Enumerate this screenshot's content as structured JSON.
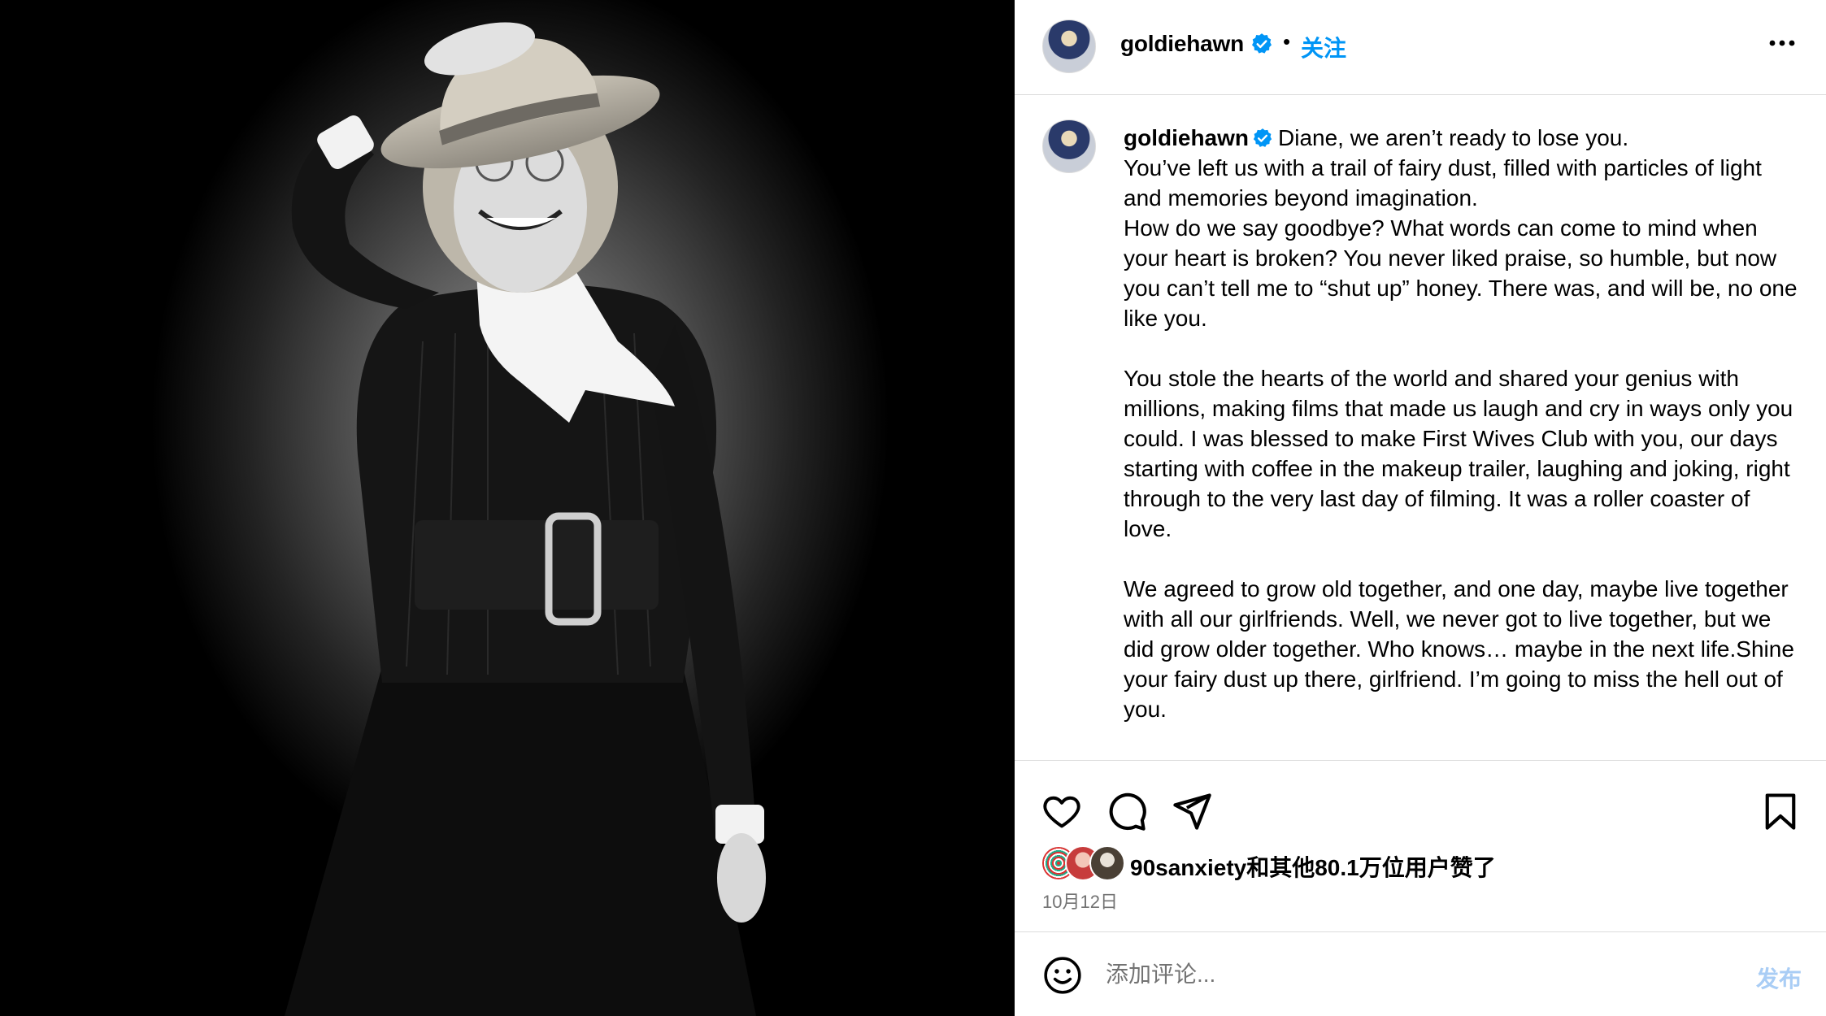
{
  "media": {
    "alt_icon": "photo-portrait",
    "colors": {
      "background": "#000000",
      "spotlight": "#9a9a9a"
    }
  },
  "post": {
    "header": {
      "username": "goldiehawn",
      "verified_icon": "verified-badge-icon",
      "separator": "•",
      "follow_label": "关注",
      "more_icon": "more-options-icon"
    },
    "caption": {
      "username": "goldiehawn",
      "text": "Diane, we aren’t ready to lose you.\nYou’ve left us with a trail of fairy dust, filled with particles of light and memories beyond imagination.\nHow do we say goodbye? What words can come to mind when your heart is broken? You never liked praise, so humble, but now you can’t tell me to “shut up” honey. There was, and will be, no one like you.\n\nYou stole the hearts of the world and shared your genius with millions, making films that made us laugh and cry in ways only you could. I was blessed to make First Wives Club with you, our days starting with coffee in the makeup trailer, laughing and joking, right through to the very last day of filming. It was a roller coaster of love.\n\nWe agreed to grow old together, and one day, maybe live together with all our girlfriends. Well, we never got to live together, but we did grow older together. Who knows… maybe in the next life.Shine your fairy dust up there, girlfriend. I’m going to miss the hell out of you."
    },
    "actions": {
      "icons": [
        "heart-icon",
        "comment-icon",
        "share-icon",
        "bookmark-icon"
      ],
      "likes_text": "90sanxiety和其他80.1万位用户赞了",
      "date": "10月12日"
    },
    "comment": {
      "emoji_icon": "emoji-icon",
      "placeholder": "添加评论...",
      "post_label": "发布"
    },
    "colors": {
      "accent": "#0095f6",
      "post_disabled": "#a9cdf5",
      "muted": "#737373",
      "divider": "#dbdbdb"
    }
  }
}
